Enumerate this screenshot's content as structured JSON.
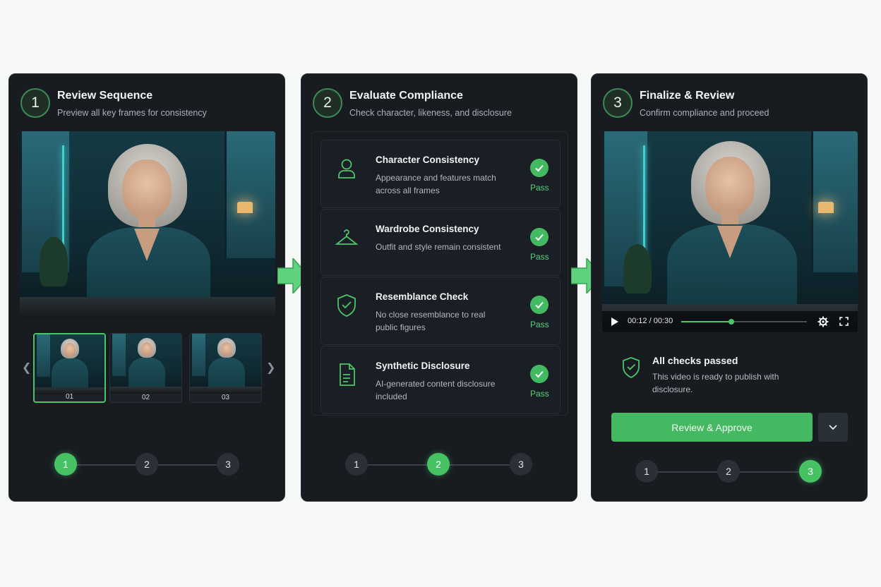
{
  "panels": [
    {
      "step": "1",
      "title": "Review Sequence",
      "subtitle": "Preview all key frames for consistency"
    },
    {
      "step": "2",
      "title": "Evaluate Compliance",
      "subtitle": "Check character, likeness, and disclosure"
    },
    {
      "step": "3",
      "title": "Finalize & Review",
      "subtitle": "Confirm compliance and proceed"
    }
  ],
  "thumbnails": [
    {
      "label": "01",
      "selected": true
    },
    {
      "label": "02",
      "selected": false
    },
    {
      "label": "03",
      "selected": false
    }
  ],
  "stepper_labels": [
    "1",
    "2",
    "3"
  ],
  "stepper_active": [
    1,
    2,
    3
  ],
  "checks": [
    {
      "title": "Character Consistency",
      "description": "Appearance and features match across all frames",
      "status": "Pass",
      "icon": "person-icon"
    },
    {
      "title": "Wardrobe Consistency",
      "description": "Outfit and style remain consistent",
      "status": "Pass",
      "icon": "hanger-icon"
    },
    {
      "title": "Resemblance Check",
      "description": "No close resemblance to real public figures",
      "status": "Pass",
      "icon": "shield-check-icon"
    },
    {
      "title": "Synthetic Disclosure",
      "description": "AI-generated content disclosure included",
      "status": "Pass",
      "icon": "document-icon"
    }
  ],
  "video": {
    "time": "00:12 / 00:30",
    "progress": 0.4
  },
  "result": {
    "title": "All checks passed",
    "description": "This video is ready to publish with disclosure."
  },
  "actions": {
    "approve_label": "Review & Approve"
  },
  "colors": {
    "accent": "#46c263",
    "panel": "#181c21",
    "background": "#f6f7f7"
  }
}
